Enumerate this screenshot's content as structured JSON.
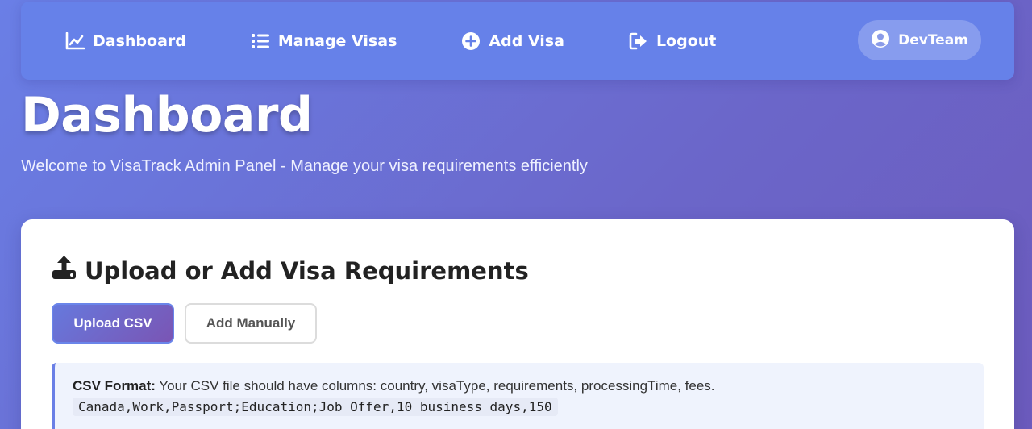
{
  "nav": {
    "items": [
      {
        "label": "Dashboard",
        "icon": "chart-line-icon"
      },
      {
        "label": "Manage Visas",
        "icon": "list-icon"
      },
      {
        "label": "Add Visa",
        "icon": "plus-circle-icon"
      },
      {
        "label": "Logout",
        "icon": "sign-out-icon"
      }
    ],
    "user": {
      "label": "DevTeam",
      "icon": "user-circle-icon"
    }
  },
  "header": {
    "title": "Dashboard",
    "subtitle": "Welcome to VisaTrack Admin Panel - Manage your visa requirements efficiently"
  },
  "upload_card": {
    "title": "Upload or Add Visa Requirements",
    "icon": "upload-icon",
    "upload_button": "Upload CSV",
    "manual_button": "Add Manually",
    "info": {
      "label": "CSV Format:",
      "text": "Your CSV file should have columns: country, visaType, requirements, processingTime, fees.",
      "example": "Canada,Work,Passport;Education;Job Offer,10 business days,150"
    }
  },
  "colors": {
    "accent": "#6681e9",
    "primary_button": "#6679dd",
    "info_border": "#6a7fe6"
  }
}
